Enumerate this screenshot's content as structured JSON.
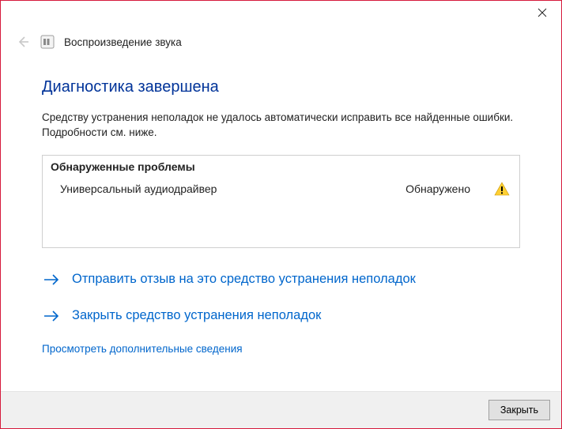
{
  "window": {
    "troubleshooter_name": "Воспроизведение звука",
    "heading": "Диагностика завершена",
    "description": "Средству устранения неполадок не удалось автоматически исправить все найденные ошибки. Подробности см. ниже."
  },
  "problems": {
    "header": "Обнаруженные проблемы",
    "items": [
      {
        "name": "Универсальный аудиодрайвер",
        "status": "Обнаружено"
      }
    ]
  },
  "actions": {
    "send_feedback": "Отправить отзыв на это средство устранения неполадок",
    "close_troubleshooter": "Закрыть средство устранения неполадок",
    "view_more": "Просмотреть дополнительные сведения"
  },
  "footer": {
    "close_button": "Закрыть"
  }
}
